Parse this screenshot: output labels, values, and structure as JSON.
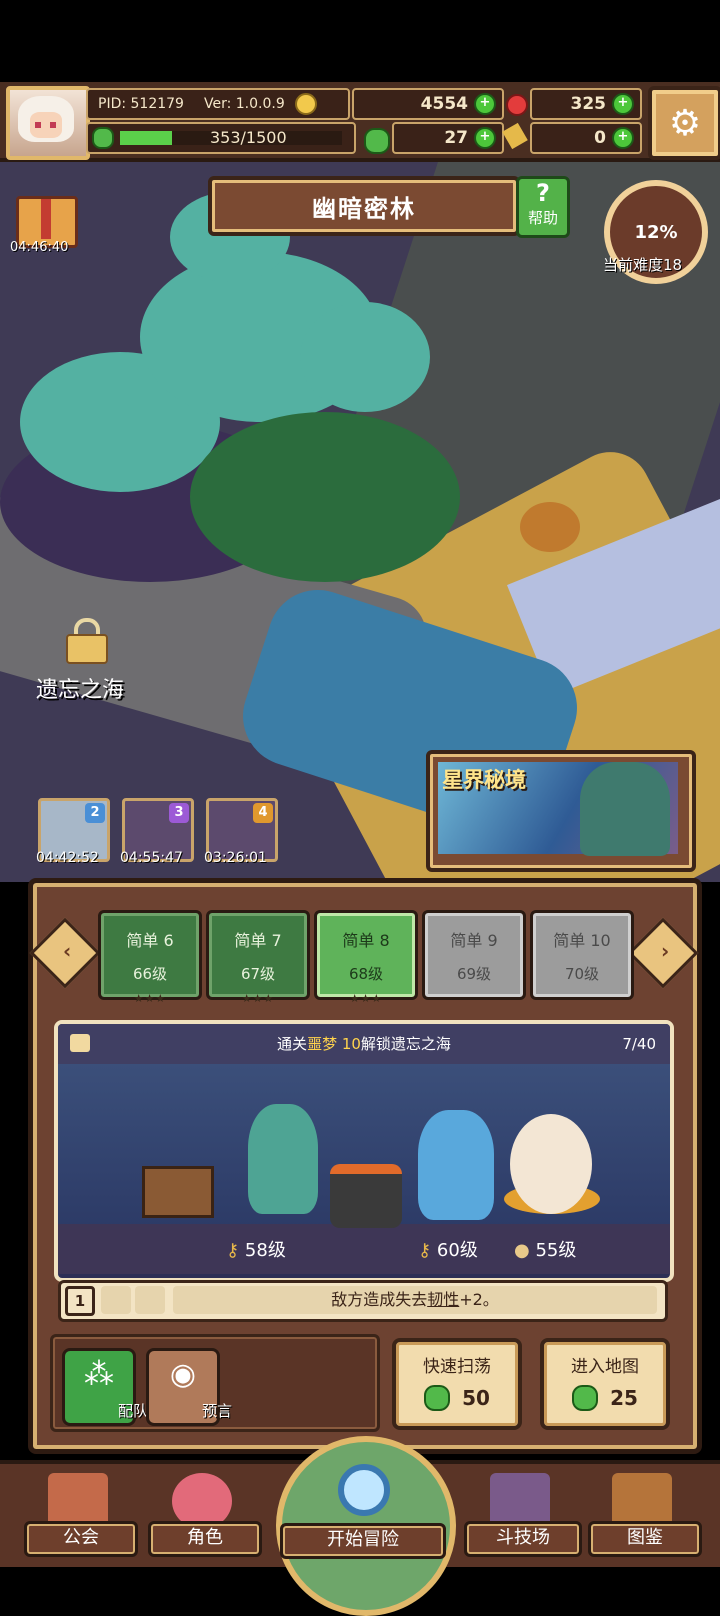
{
  "header": {
    "pid": "PID: 512179",
    "version": "Ver: 1.0.0.9",
    "coins": "4554",
    "gems": "325",
    "exp": "353/1500",
    "clovers": "27",
    "keys": "0",
    "exp_progress": 0.235
  },
  "map": {
    "area_title": "幽暗密林",
    "help_label": "帮助",
    "gift_timer": "04:46:40",
    "difficulty_percent": "12%",
    "difficulty_label": "当前难度18",
    "locked_area": "遗忘之海",
    "star_realm_title": "星界秘境",
    "queue": [
      {
        "badge": "2",
        "time": "04:42:52"
      },
      {
        "badge": "3",
        "time": "04:55:47"
      },
      {
        "badge": "4",
        "time": "03:26:01"
      }
    ]
  },
  "stages": [
    {
      "name": "简单 6",
      "level": "66级",
      "stars": "★★★"
    },
    {
      "name": "简单 7",
      "level": "67级",
      "stars": "★★★"
    },
    {
      "name": "简单 8",
      "level": "68级",
      "stars": "★★★"
    },
    {
      "name": "简单 9",
      "level": "69级",
      "stars": ""
    },
    {
      "name": "简单 10",
      "level": "70级",
      "stars": ""
    }
  ],
  "battle": {
    "unlock_prefix": "通关",
    "unlock_highlight": "噩梦 10",
    "unlock_suffix": "解锁遗忘之海",
    "progress": "7/40",
    "enemy_levels": [
      "58级",
      "60级",
      "55级"
    ]
  },
  "skill": {
    "number": "1",
    "description_prefix": "敌方造成失去",
    "description_highlight": "韧性",
    "description_suffix": "+2。"
  },
  "actions": {
    "team_label": "配队",
    "prophecy_label": "预言",
    "sweep_label": "快速扫荡",
    "sweep_cost": "50",
    "enter_label": "进入地图",
    "enter_cost": "25"
  },
  "nav": {
    "guild": "公会",
    "character": "角色",
    "start": "开始冒险",
    "arena": "斗技场",
    "codex": "图鉴"
  },
  "colors": {
    "frame": "#6d4231",
    "gold": "#d7b071",
    "active_stage": "#5fb35a",
    "locked_stage": "#9c9c9c"
  }
}
